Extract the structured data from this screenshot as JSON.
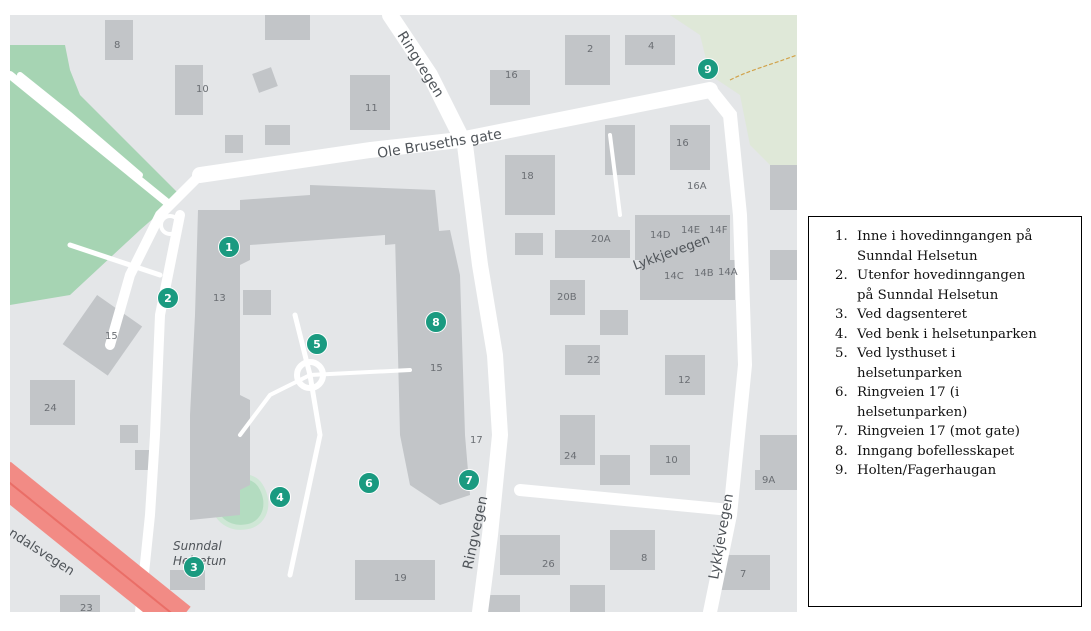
{
  "map": {
    "streets": {
      "ringvegen": "Ringvegen",
      "ole_bruseths_gate": "Ole Bruseths gate",
      "lykkjevegen": "Lykkjevegen",
      "sunndalsvegen": "ndalsvegen",
      "place_sunndal": "Sunndal",
      "place_helsetun": "Helsetun"
    },
    "addresses": [
      "8",
      "10",
      "11",
      "16",
      "2",
      "4",
      "18",
      "16",
      "16A",
      "13",
      "20A",
      "14D",
      "14E",
      "14F",
      "14C",
      "14B",
      "14A",
      "15",
      "20B",
      "22",
      "15",
      "12",
      "24",
      "17",
      "24",
      "10",
      "9A",
      "26",
      "8",
      "7",
      "19",
      "23"
    ],
    "markers": [
      "1",
      "2",
      "3",
      "4",
      "5",
      "6",
      "7",
      "8",
      "9"
    ],
    "colors": {
      "marker": "#1a9a80",
      "road": "#ffffff",
      "building": "#c2c5c8",
      "park": "#a6d4b3",
      "main_road": "#f28b85"
    }
  },
  "legend": {
    "items": [
      {
        "num": "1.",
        "lines": [
          "Inne i hovedinngangen på",
          "Sunndal Helsetun"
        ]
      },
      {
        "num": "2.",
        "lines": [
          "Utenfor hovedinngangen",
          "på Sunndal Helsetun"
        ]
      },
      {
        "num": "3.",
        "lines": [
          "Ved dagsenteret"
        ]
      },
      {
        "num": "4.",
        "lines": [
          "Ved benk i helsetunparken"
        ]
      },
      {
        "num": "5.",
        "lines": [
          "Ved lysthuset i",
          "helsetunparken"
        ]
      },
      {
        "num": "6.",
        "lines": [
          "Ringveien 17 (i",
          "helsetunparken)"
        ]
      },
      {
        "num": "7.",
        "lines": [
          "Ringveien 17 (mot gate)"
        ]
      },
      {
        "num": "8.",
        "lines": [
          "Inngang bofellesskapet"
        ]
      },
      {
        "num": "9.",
        "lines": [
          "Holten/Fagerhaugan"
        ]
      }
    ]
  }
}
